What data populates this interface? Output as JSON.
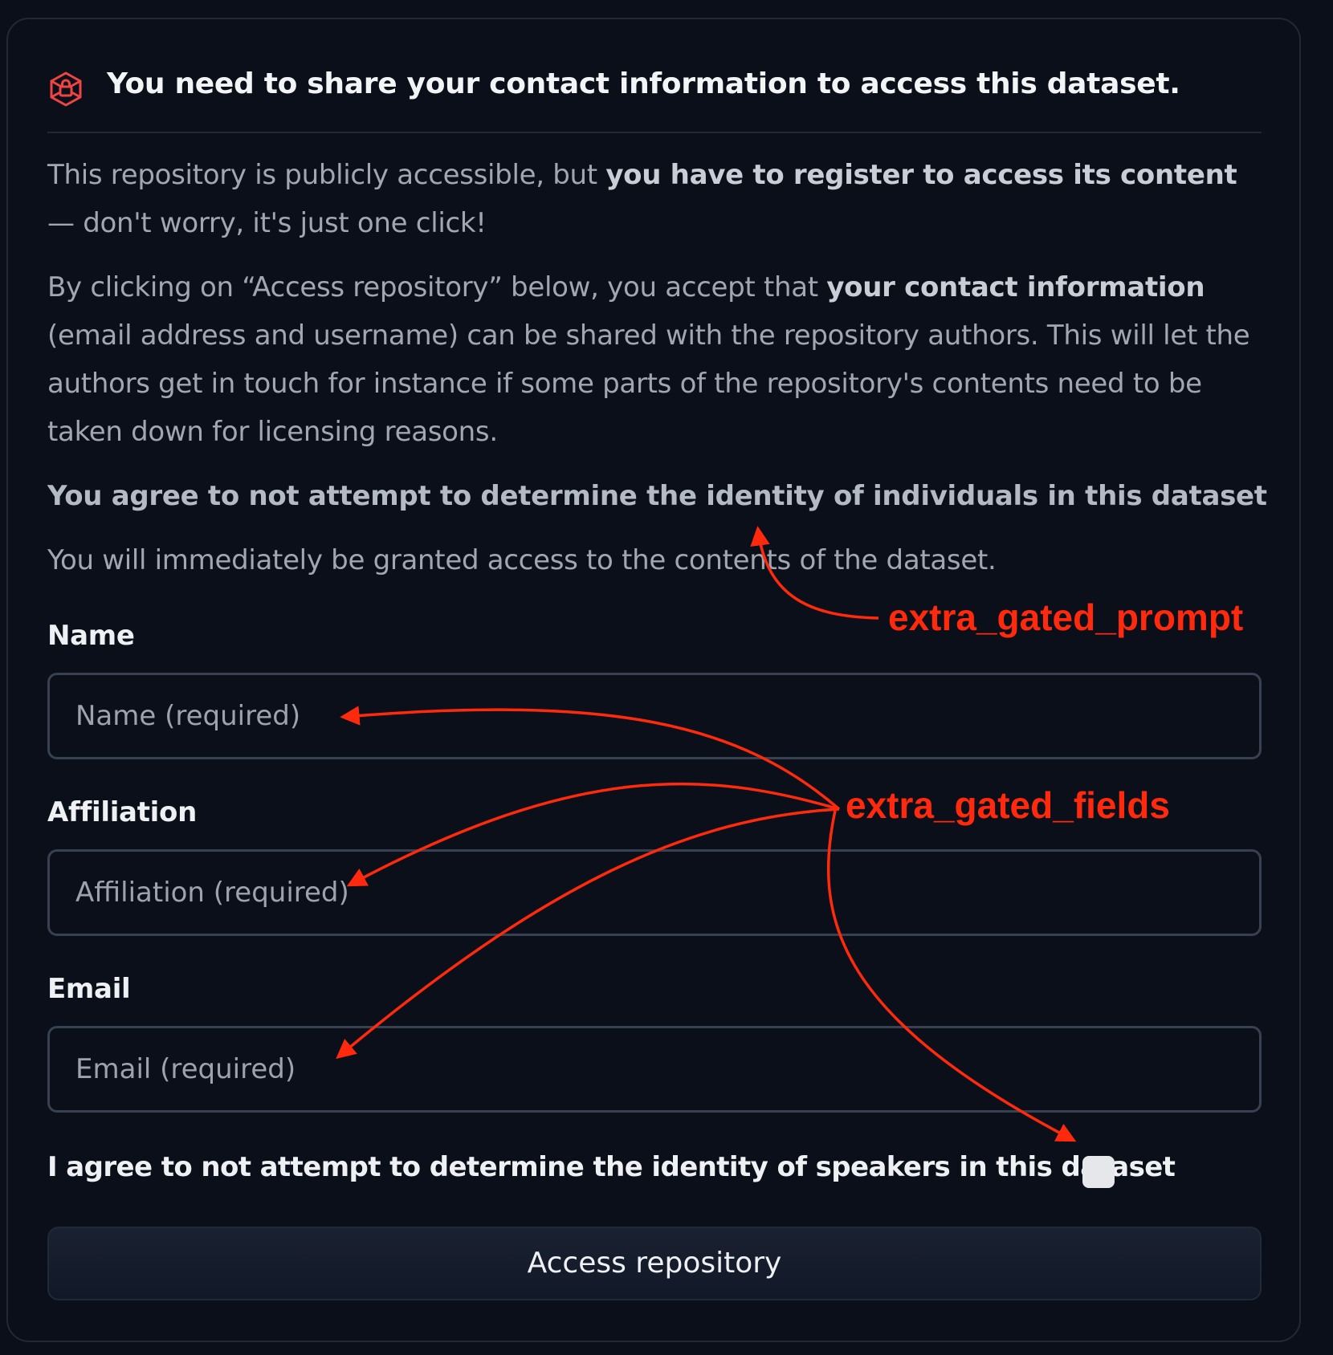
{
  "header": {
    "title": "You need to share your contact information to access this dataset.",
    "icon": "lock-icon"
  },
  "intro": {
    "p1_a": "This repository is publicly accessible, but ",
    "p1_strong": "you have to register to access its content",
    "p1_b": " — don't worry, it's just one click!",
    "p2_a": "By clicking on “Access repository” below, you accept that ",
    "p2_strong": "your contact information",
    "p2_b": " (email address and username) can be shared with the repository authors. This will let the authors get in touch for instance if some parts of the repository's contents need to be taken down for licensing reasons.",
    "p3": "You agree to not attempt to determine the identity of individuals in this dataset",
    "p4": "You will immediately be granted access to the contents of the dataset."
  },
  "form": {
    "name_label": "Name",
    "name_placeholder": "Name (required)",
    "affiliation_label": "Affiliation",
    "affiliation_placeholder": "Affiliation (required)",
    "email_label": "Email",
    "email_placeholder": "Email (required)",
    "agree_label": "I agree to not attempt to determine the identity of speakers in this dataset",
    "submit_label": "Access repository"
  },
  "annotations": {
    "prompt_label": "extra_gated_prompt",
    "fields_label": "extra_gated_fields",
    "color": "#ff2a0e"
  }
}
